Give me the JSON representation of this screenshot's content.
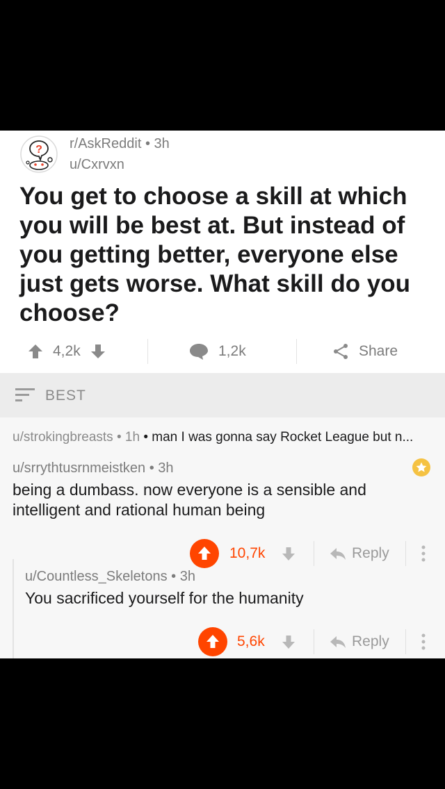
{
  "post": {
    "subreddit": "r/AskReddit",
    "age": "3h",
    "author": "u/Cxrvxn",
    "title": "You get to choose a skill at which you will be best at. But instead of you getting better, everyone else just gets worse. What skill do you choose?",
    "score": "4,2k",
    "comments": "1,2k",
    "share_label": "Share"
  },
  "sort": {
    "label": "BEST"
  },
  "collapsed_comment": {
    "author": "u/strokingbreasts",
    "age": "1h",
    "body": "man I was gonna say Rocket League but n..."
  },
  "comments": [
    {
      "author": "u/srrythtusrnmeistken",
      "age": "3h",
      "body": "being a dumbass. now everyone is a sensible and intelligent and rational human being",
      "score": "10,7k",
      "reply_label": "Reply"
    },
    {
      "author": "u/Countless_Skeletons",
      "age": "3h",
      "body": "You sacrificed yourself for the humanity",
      "score": "5,6k",
      "reply_label": "Reply"
    }
  ],
  "colors": {
    "upvote": "#ff4500",
    "award": "#f5c242",
    "meta": "#7c7c7c"
  },
  "icons": [
    "askreddit-snoo-icon",
    "upvote-icon",
    "downvote-icon",
    "comment-icon",
    "share-icon",
    "sort-icon",
    "award-icon",
    "reply-icon",
    "kebab-icon"
  ]
}
